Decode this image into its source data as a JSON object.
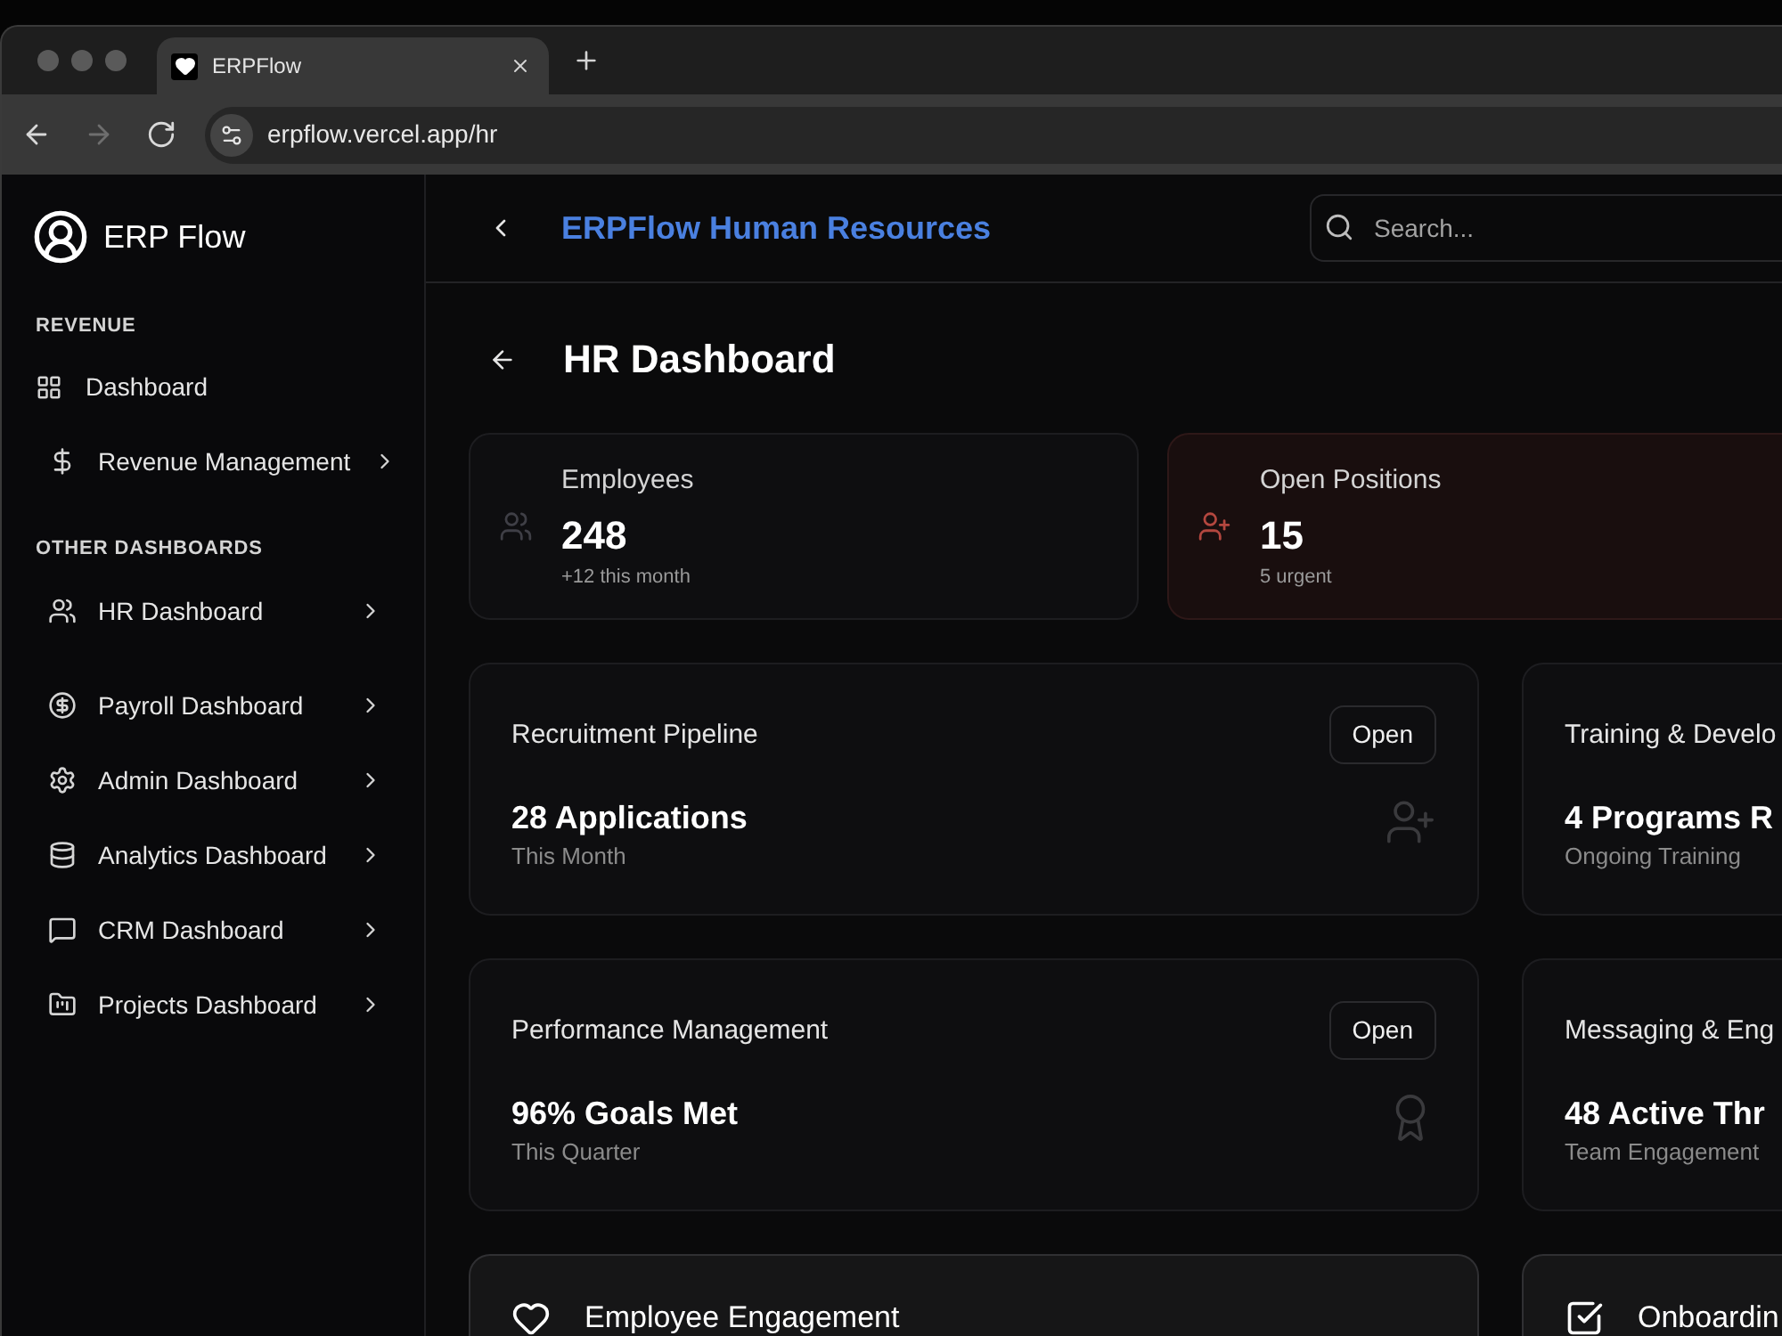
{
  "browser": {
    "tabs": [
      {
        "title": "ERPFlow",
        "selected": true
      }
    ],
    "nav_buttons": [
      {
        "kind": "back",
        "disabled": false
      },
      {
        "kind": "forward",
        "disabled": true
      },
      {
        "kind": "reload",
        "disabled": false
      }
    ],
    "address": "erpflow.vercel.app/hr"
  },
  "sidebar": {
    "brand": "ERP Flow",
    "sections": [
      {
        "heading": "REVENUE",
        "items": [
          {
            "label": "Dashboard",
            "kind": "link"
          },
          {
            "label": "Revenue Management",
            "kind": "menu"
          }
        ]
      },
      {
        "heading": "OTHER DASHBOARDS",
        "items": [
          {
            "label": "HR Dashboard",
            "kind": "menu"
          },
          {
            "label": "Payroll Dashboard",
            "kind": "menu"
          },
          {
            "label": "Admin Dashboard",
            "kind": "menu"
          },
          {
            "label": "Analytics Dashboard",
            "kind": "menu"
          },
          {
            "label": "CRM Dashboard",
            "kind": "menu"
          },
          {
            "label": "Projects Dashboard",
            "kind": "menu"
          }
        ]
      }
    ]
  },
  "header": {
    "title": "ERPFlow Human Resources",
    "search": {
      "placeholder": "Search..."
    }
  },
  "page": {
    "title": "HR Dashboard"
  },
  "stats": [
    {
      "label": "Employees",
      "value": "248",
      "note": "+12 this month",
      "kind": "neutral"
    },
    {
      "label": "Open Positions",
      "value": "15",
      "note": "5 urgent",
      "kind": "alert"
    }
  ],
  "modules": [
    {
      "title": "Recruitment Pipeline",
      "action": "Open",
      "value": "28 Applications",
      "caption": "This Month"
    },
    {
      "title": "Training & Develo",
      "value": "4 Programs R",
      "caption": "Ongoing Training"
    },
    {
      "title": "Performance Management",
      "action": "Open",
      "value": "96% Goals Met",
      "caption": "This Quarter"
    },
    {
      "title": "Messaging & Eng",
      "value": "48 Active Thr",
      "caption": "Team Engagement"
    }
  ],
  "sections": [
    {
      "title": "Employee Engagement"
    },
    {
      "title": "Onboardin"
    }
  ]
}
